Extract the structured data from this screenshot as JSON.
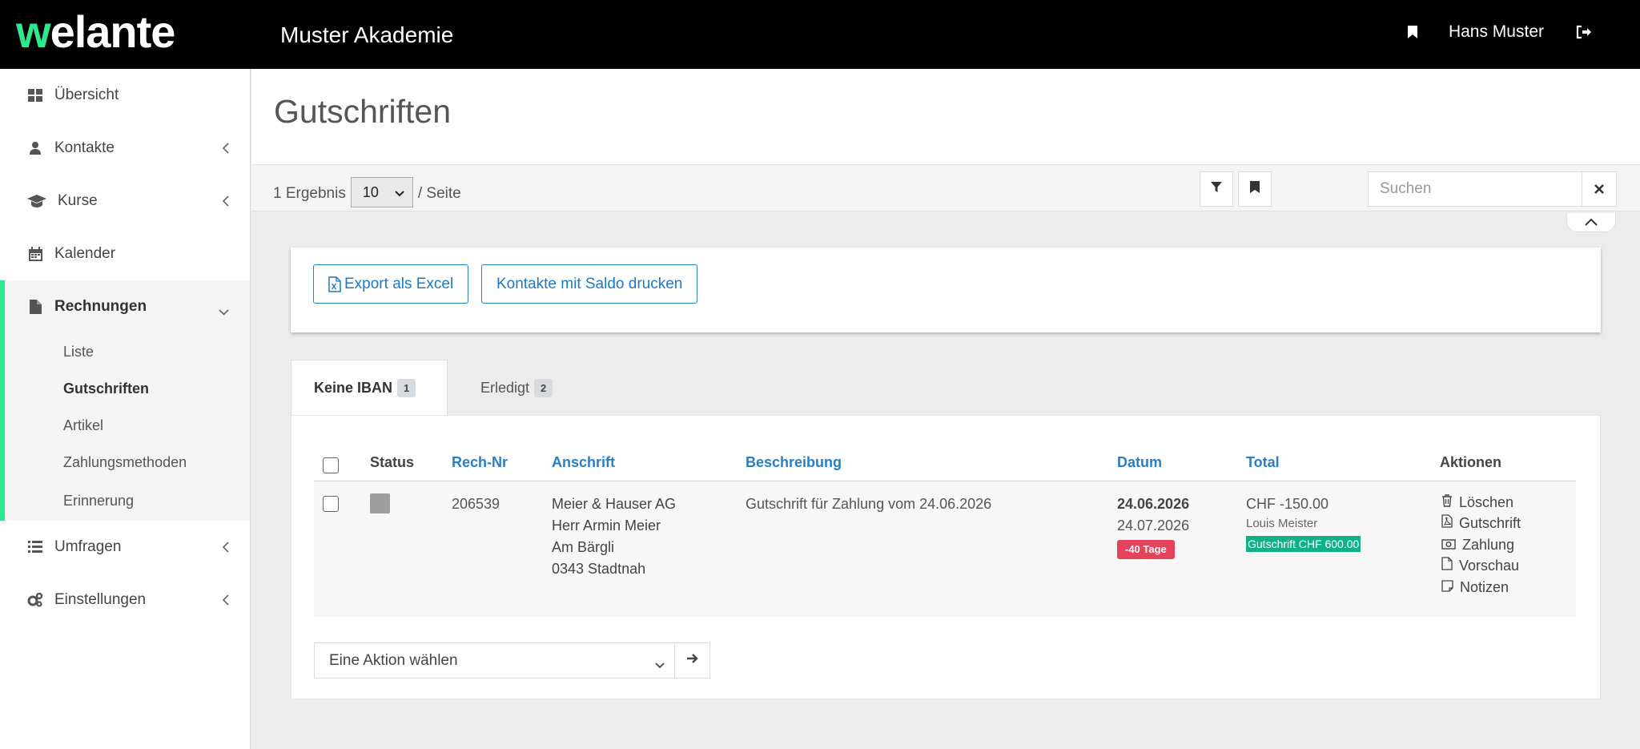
{
  "header": {
    "logo_w": "w",
    "logo_rest": "elante",
    "academy": "Muster Akademie",
    "user": "Hans Muster"
  },
  "sidebar": {
    "items": [
      {
        "label": "Übersicht",
        "icon": "dashboard-icon"
      },
      {
        "label": "Kontakte",
        "icon": "user-icon"
      },
      {
        "label": "Kurse",
        "icon": "graduation-cap-icon"
      },
      {
        "label": "Kalender",
        "icon": "calendar-icon"
      },
      {
        "label": "Rechnungen",
        "icon": "file-icon"
      },
      {
        "label": "Umfragen",
        "icon": "list-icon"
      },
      {
        "label": "Einstellungen",
        "icon": "cogs-icon"
      }
    ],
    "sub": [
      "Liste",
      "Gutschriften",
      "Artikel",
      "Zahlungsmethoden",
      "Erinnerung"
    ],
    "accent": "#2ee88e"
  },
  "page": {
    "title": "Gutschriften",
    "results": "1 Ergebnis",
    "per_page_value": "10",
    "per_page_suffix": "/ Seite",
    "search_placeholder": "Suchen"
  },
  "buttons": {
    "export": "Export als Excel",
    "print": "Kontakte mit Saldo drucken"
  },
  "tabs": [
    {
      "label": "Keine IBAN",
      "count": "1"
    },
    {
      "label": "Erledigt",
      "count": "2"
    }
  ],
  "table": {
    "headers": [
      "Status",
      "Rech-Nr",
      "Anschrift",
      "Beschreibung",
      "Datum",
      "Total",
      "Aktionen"
    ],
    "row": {
      "number": "206539",
      "address": [
        "Meier & Hauser AG",
        "Herr Armin Meier",
        "Am Bärgli",
        "0343 Stadtnah"
      ],
      "description": "Gutschrift für Zahlung vom 24.06.2026",
      "date": "24.06.2026",
      "due_date": "24.07.2026",
      "days": "-40 Tage",
      "total": "CHF -150.00",
      "person": "Louis Meister",
      "credit": "Gutschrift CHF 600.00",
      "actions": [
        "Löschen",
        "Gutschrift",
        "Zahlung",
        "Vorschau",
        "Notizen"
      ]
    }
  },
  "bulk": {
    "placeholder": "Eine Aktion wählen"
  },
  "colors": {
    "link": "#2a7ec5",
    "danger": "#e4435a",
    "success": "#13b087"
  }
}
